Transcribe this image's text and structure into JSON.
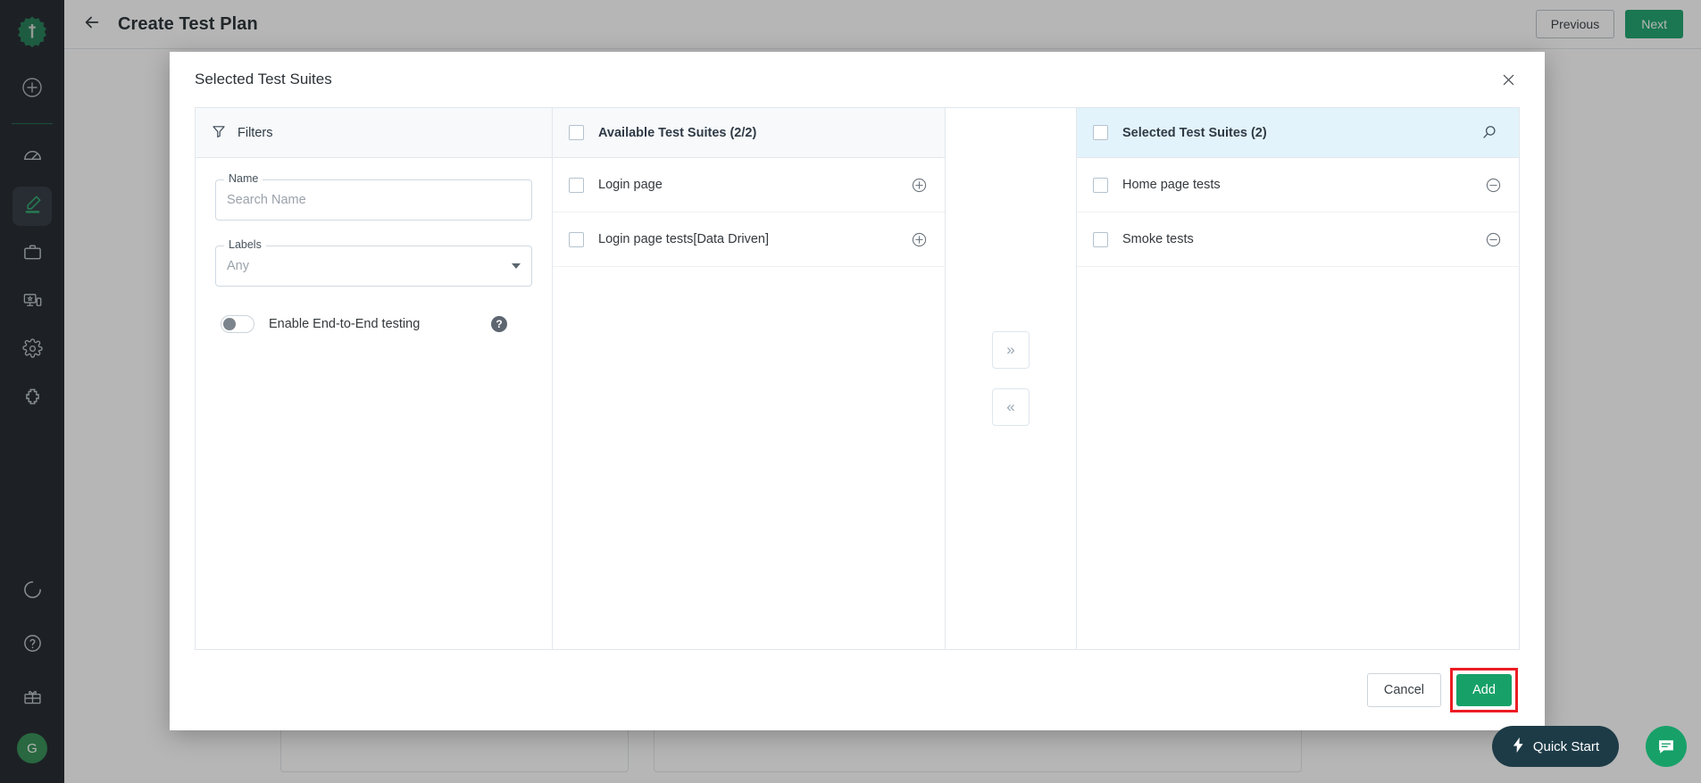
{
  "rail": {
    "logo_icon": "tricentis-gear-logo",
    "add_icon": "plus-circle-icon",
    "items": [
      {
        "icon": "speedometer-icon",
        "name": "dashboard",
        "active": false
      },
      {
        "icon": "pencil-edit-icon",
        "name": "authoring",
        "active": true
      },
      {
        "icon": "briefcase-icon",
        "name": "projects",
        "active": false
      },
      {
        "icon": "devices-monitor-icon",
        "name": "devices",
        "active": false
      },
      {
        "icon": "gear-settings-icon",
        "name": "settings",
        "active": false
      },
      {
        "icon": "puzzle-piece-icon",
        "name": "integrations",
        "active": false
      }
    ],
    "bottom": [
      {
        "icon": "progress-ring-icon",
        "name": "usage"
      },
      {
        "icon": "question-circle-icon",
        "name": "help"
      },
      {
        "icon": "gift-box-icon",
        "name": "whats-new"
      }
    ],
    "avatar_initial": "G"
  },
  "topbar": {
    "back_icon": "arrow-left-icon",
    "title": "Create Test Plan",
    "previous_label": "Previous",
    "next_label": "Next"
  },
  "modal": {
    "title": "Selected Test Suites",
    "close_icon": "close-icon",
    "filters": {
      "icon": "funnel-filter-icon",
      "heading": "Filters",
      "name_field": {
        "legend": "Name",
        "value": "",
        "placeholder": "Search Name"
      },
      "labels_field": {
        "legend": "Labels",
        "value": "",
        "placeholder": "Any",
        "caret_icon": "chevron-down-icon"
      },
      "toggle": {
        "label": "Enable End-to-End testing",
        "state": "off",
        "help_icon": "help-circle-icon",
        "help_label": "?"
      }
    },
    "available": {
      "header_label": "Available Test Suites (2/2)",
      "header_checked": false,
      "rows": [
        {
          "label": "Login page",
          "checked": false,
          "action_icon": "plus-circle-outline-icon"
        },
        {
          "label": "Login page tests[Data Driven]",
          "checked": false,
          "action_icon": "plus-circle-outline-icon"
        }
      ]
    },
    "transfer": {
      "move_right_icon": "double-chevron-right-icon",
      "move_right_label": "»",
      "move_left_icon": "double-chevron-left-icon",
      "move_left_label": "«"
    },
    "selected": {
      "header_label": "Selected Test Suites (2)",
      "header_checked": false,
      "search_icon": "search-icon",
      "rows": [
        {
          "label": "Home page tests",
          "checked": false,
          "action_icon": "minus-circle-outline-icon"
        },
        {
          "label": "Smoke tests",
          "checked": false,
          "action_icon": "minus-circle-outline-icon"
        }
      ]
    },
    "footer": {
      "cancel_label": "Cancel",
      "add_label": "Add",
      "add_highlight_color": "#ec1c24"
    }
  },
  "floating": {
    "quick_start_label": "Quick Start",
    "quick_start_icon": "lightning-bolt-icon",
    "chat_icon": "chat-bubble-icon"
  },
  "colors": {
    "brand_green": "#17a169",
    "rail_bg": "#1b2127",
    "selected_header_bg": "#e3f3fc",
    "panel_header_bg": "#f7f9fb",
    "highlight_red": "#ec1c24"
  }
}
